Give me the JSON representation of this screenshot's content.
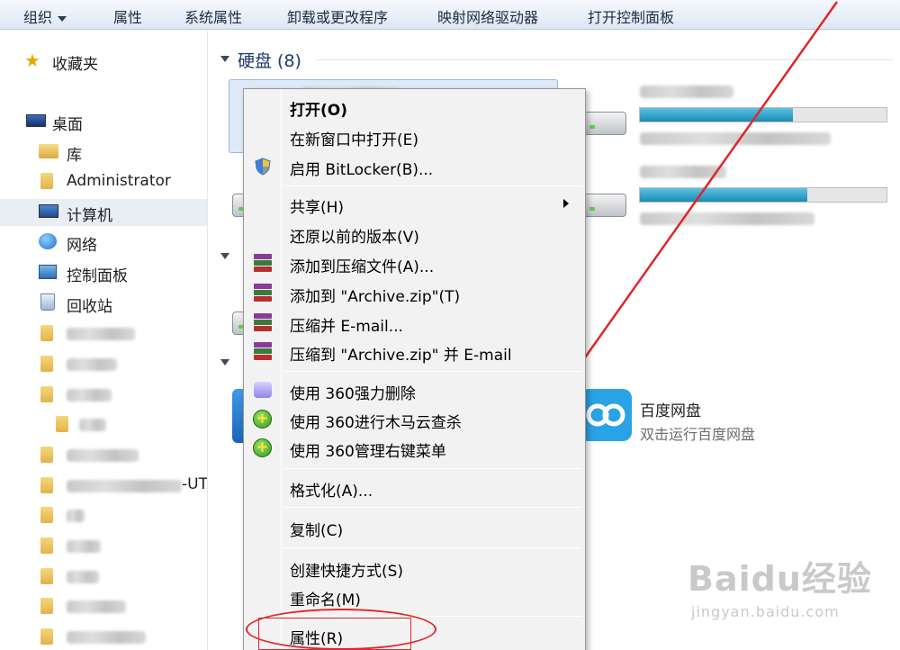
{
  "toolbar": {
    "items": [
      "组织",
      "属性",
      "系统属性",
      "卸载或更改程序",
      "映射网络驱动器",
      "打开控制面板"
    ]
  },
  "sidebar": {
    "favorites": "收藏夹",
    "desktop": "桌面",
    "libraries": "库",
    "user": "Administrator",
    "computer": "计算机",
    "network": "网络",
    "control_panel": "控制面板",
    "recycle_bin": "回收站",
    "partial_label": "-UT"
  },
  "main": {
    "hard_drives_group": "硬盘 (8)",
    "drive_bars_fill": [
      0.62,
      0.68
    ],
    "app_title": "百度网盘",
    "app_subtitle": "双击运行百度网盘"
  },
  "context_menu": {
    "open": "打开(O)",
    "open_new_window": "在新窗口中打开(E)",
    "bitlocker": "启用 BitLocker(B)...",
    "share": "共享(H)",
    "restore": "还原以前的版本(V)",
    "add_archive": "添加到压缩文件(A)...",
    "add_zip": "添加到 \"Archive.zip\"(T)",
    "compress_email": "压缩并 E-mail...",
    "compress_zip_email": "压缩到 \"Archive.zip\" 并 E-mail",
    "shred_360": "使用 360强力删除",
    "scan_360": "使用 360进行木马云查杀",
    "manage_360": "使用 360管理右键菜单",
    "format": "格式化(A)...",
    "copy": "复制(C)",
    "shortcut": "创建快捷方式(S)",
    "rename": "重命名(M)",
    "properties": "属性(R)"
  },
  "watermark": {
    "logo": "Baidu经验",
    "url": "jingyan.baidu.com"
  },
  "colors": {
    "annotation_red": "#e0262d",
    "accent_blue": "#1e3a6e"
  }
}
